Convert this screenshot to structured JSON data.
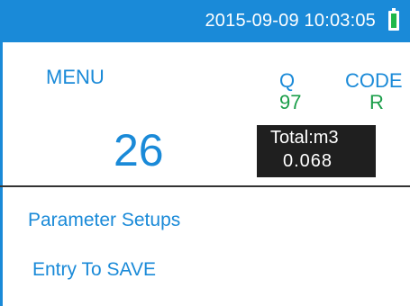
{
  "status": {
    "datetime": "2015-09-09 10:03:05",
    "battery_icon": "battery-icon",
    "bar_color": "#1a8ad8",
    "battery_color": "#1fb84a"
  },
  "header": {
    "menu_label": "MENU",
    "q_label": "Q",
    "q_value": "97",
    "code_label": "CODE",
    "code_value": "R"
  },
  "display": {
    "number": "26",
    "total_label": "Total:m3",
    "total_value": "0.068"
  },
  "menu": {
    "items": [
      {
        "label": "Parameter Setups"
      },
      {
        "label": "Entry To SAVE"
      }
    ]
  }
}
